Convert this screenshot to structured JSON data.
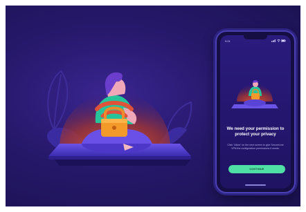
{
  "phone": {
    "status_time": "9:01",
    "title": "We need your permission to protect your privacy",
    "description": "Click \"Allow\" on the next screen to give SecureLine VPN the configuration permissions it needs.",
    "cta_label": "CONTINUE"
  },
  "icons": [
    "padlock-icon",
    "signal-icon",
    "wifi-icon",
    "battery-icon"
  ],
  "colors": {
    "background": "#26186a",
    "phone_screen": "#2a1b7d",
    "accent_orange": "#e36a2a",
    "cta_green": "#4fe0a6",
    "shirt_teal": "#27c39a"
  }
}
